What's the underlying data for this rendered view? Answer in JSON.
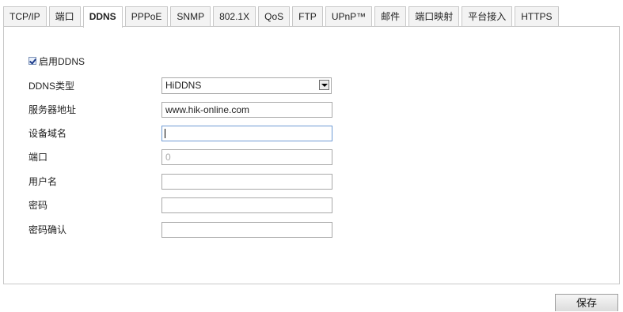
{
  "tabs": [
    {
      "label": "TCP/IP",
      "active": false
    },
    {
      "label": "端口",
      "active": false
    },
    {
      "label": "DDNS",
      "active": true
    },
    {
      "label": "PPPoE",
      "active": false
    },
    {
      "label": "SNMP",
      "active": false
    },
    {
      "label": "802.1X",
      "active": false
    },
    {
      "label": "QoS",
      "active": false
    },
    {
      "label": "FTP",
      "active": false
    },
    {
      "label": "UPnP™",
      "active": false
    },
    {
      "label": "邮件",
      "active": false
    },
    {
      "label": "端口映射",
      "active": false
    },
    {
      "label": "平台接入",
      "active": false
    },
    {
      "label": "HTTPS",
      "active": false
    }
  ],
  "ddns": {
    "enable_label": "启用DDNS",
    "enabled": true,
    "type_label": "DDNS类型",
    "type_value": "HiDDNS",
    "server_label": "服务器地址",
    "server_value": "www.hik-online.com",
    "domain_label": "设备域名",
    "domain_value": "",
    "port_label": "端口",
    "port_value": "0",
    "username_label": "用户名",
    "username_value": "",
    "password_label": "密码",
    "password_value": "",
    "confirm_label": "密码确认",
    "confirm_value": ""
  },
  "actions": {
    "save_label": "保存"
  }
}
